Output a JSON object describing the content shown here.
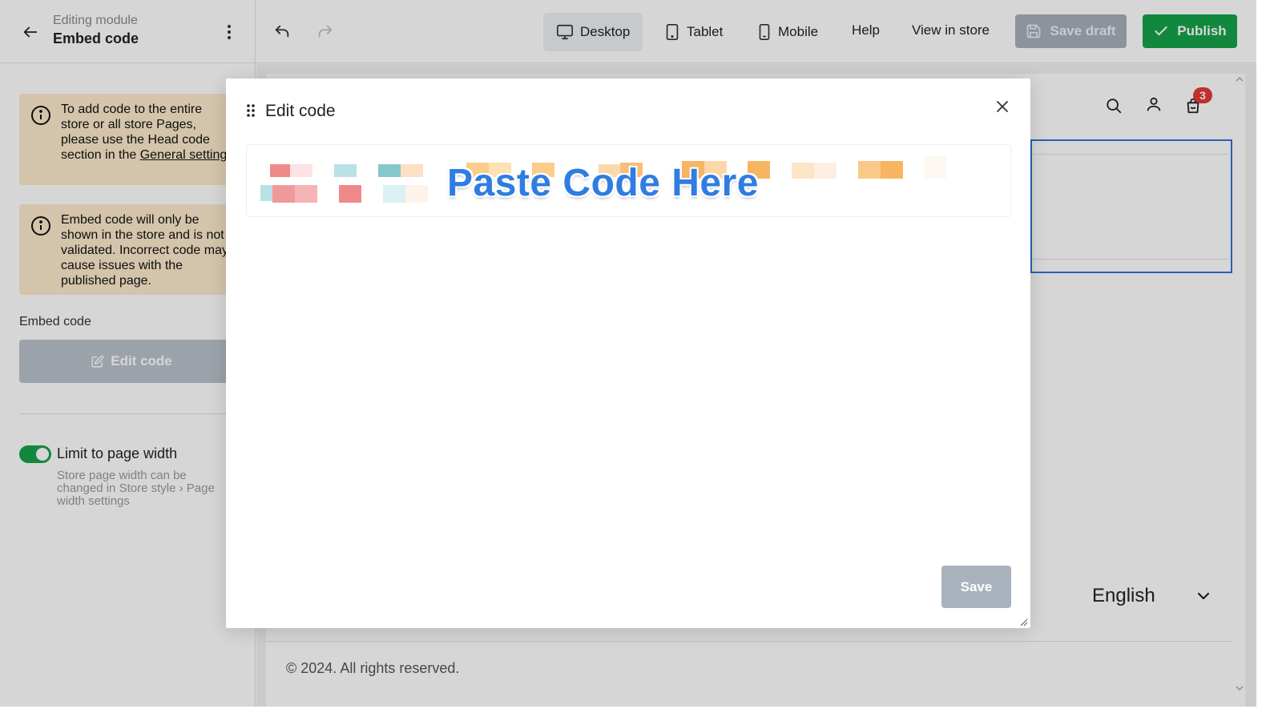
{
  "header": {
    "editing_label": "Editing module",
    "module_title": "Embed code",
    "devices": [
      {
        "label": "Desktop",
        "icon": "monitor-icon",
        "active": true
      },
      {
        "label": "Tablet",
        "icon": "tablet-icon",
        "active": false
      },
      {
        "label": "Mobile",
        "icon": "mobile-icon",
        "active": false
      }
    ],
    "help_label": "Help",
    "view_store_label": "View in store",
    "save_draft_label": "Save draft",
    "publish_label": "Publish"
  },
  "sidebar": {
    "notice_1_text": "To add code to the entire store or all store Pages, please use the Head code section in the ",
    "notice_1_link": "General settings",
    "notice_2_text": "Embed code will only be shown in the store and is not validated. Incorrect code may cause issues with the published page.",
    "embed_label": "Embed code",
    "edit_code_label": "Edit code",
    "toggle_label": "Limit to page width",
    "toggle_on": true,
    "toggle_help": "Store page width can be changed in Store style › Page width settings"
  },
  "preview": {
    "cart_count": "3",
    "language": "English",
    "copyright": "© 2024. All rights reserved."
  },
  "modal": {
    "title": "Edit code",
    "paste_hint": "Paste Code Here",
    "save_label": "Save"
  },
  "colors": {
    "accent_green": "#16a34a",
    "selection_blue": "#2f73d8",
    "notice_bg": "#fdeacc",
    "disabled_button": "#a9b2bd",
    "hint_blue": "#2f7de1"
  }
}
